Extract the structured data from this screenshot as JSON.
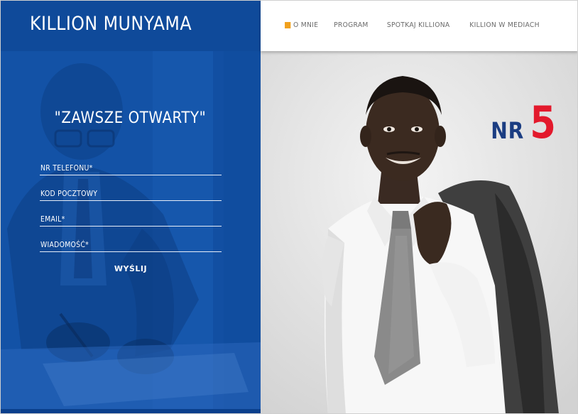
{
  "header": {
    "brand": "KILLION MUNYAMA",
    "nav": [
      "O MNIE",
      "PROGRAM",
      "SPOTKAJ KILLIONA",
      "KILLION W MEDIACH"
    ],
    "nav_accent_color": "#f1a11d"
  },
  "form": {
    "title": "\"ZAWSZE OTWARTY\"",
    "fields": [
      "NR TELEFONU*",
      "KOD POCZTOWY",
      "EMAIL*",
      "WIADOMOŚĆ*"
    ],
    "submit": "WYŚLIJ"
  },
  "badge": {
    "prefix": "NR",
    "number": "5"
  },
  "colors": {
    "brand_blue": "#0f4a9a",
    "panel_blue": "#1352a6",
    "badge_blue": "#1b3d82",
    "badge_red": "#e3192c"
  }
}
